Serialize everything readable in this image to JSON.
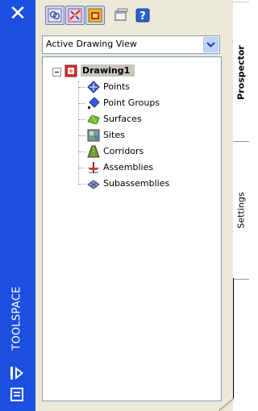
{
  "titlebar": {
    "title": "TOOLSPACE",
    "close_glyph": "✕",
    "color": "#1a4fe0"
  },
  "toolbar": {
    "buttons": [
      {
        "icon": "toggle-icon"
      },
      {
        "icon": "prospector-icon"
      },
      {
        "icon": "survey-icon"
      },
      {
        "icon": "window-icon"
      },
      {
        "icon": "help-icon",
        "glyph": "?"
      }
    ]
  },
  "view_select": {
    "selected": "Active Drawing View"
  },
  "tree": {
    "root": {
      "label": "Drawing1",
      "icon": "drawing-icon"
    },
    "items": [
      {
        "label": "Points",
        "icon": "points-icon"
      },
      {
        "label": "Point Groups",
        "icon": "point-groups-icon"
      },
      {
        "label": "Surfaces",
        "icon": "surfaces-icon"
      },
      {
        "label": "Sites",
        "icon": "sites-icon"
      },
      {
        "label": "Corridors",
        "icon": "corridors-icon"
      },
      {
        "label": "Assemblies",
        "icon": "assemblies-icon"
      },
      {
        "label": "Subassemblies",
        "icon": "subassemblies-icon"
      }
    ]
  },
  "tabs": [
    {
      "label": "Prospector",
      "active": true
    },
    {
      "label": "Settings",
      "active": false
    }
  ]
}
